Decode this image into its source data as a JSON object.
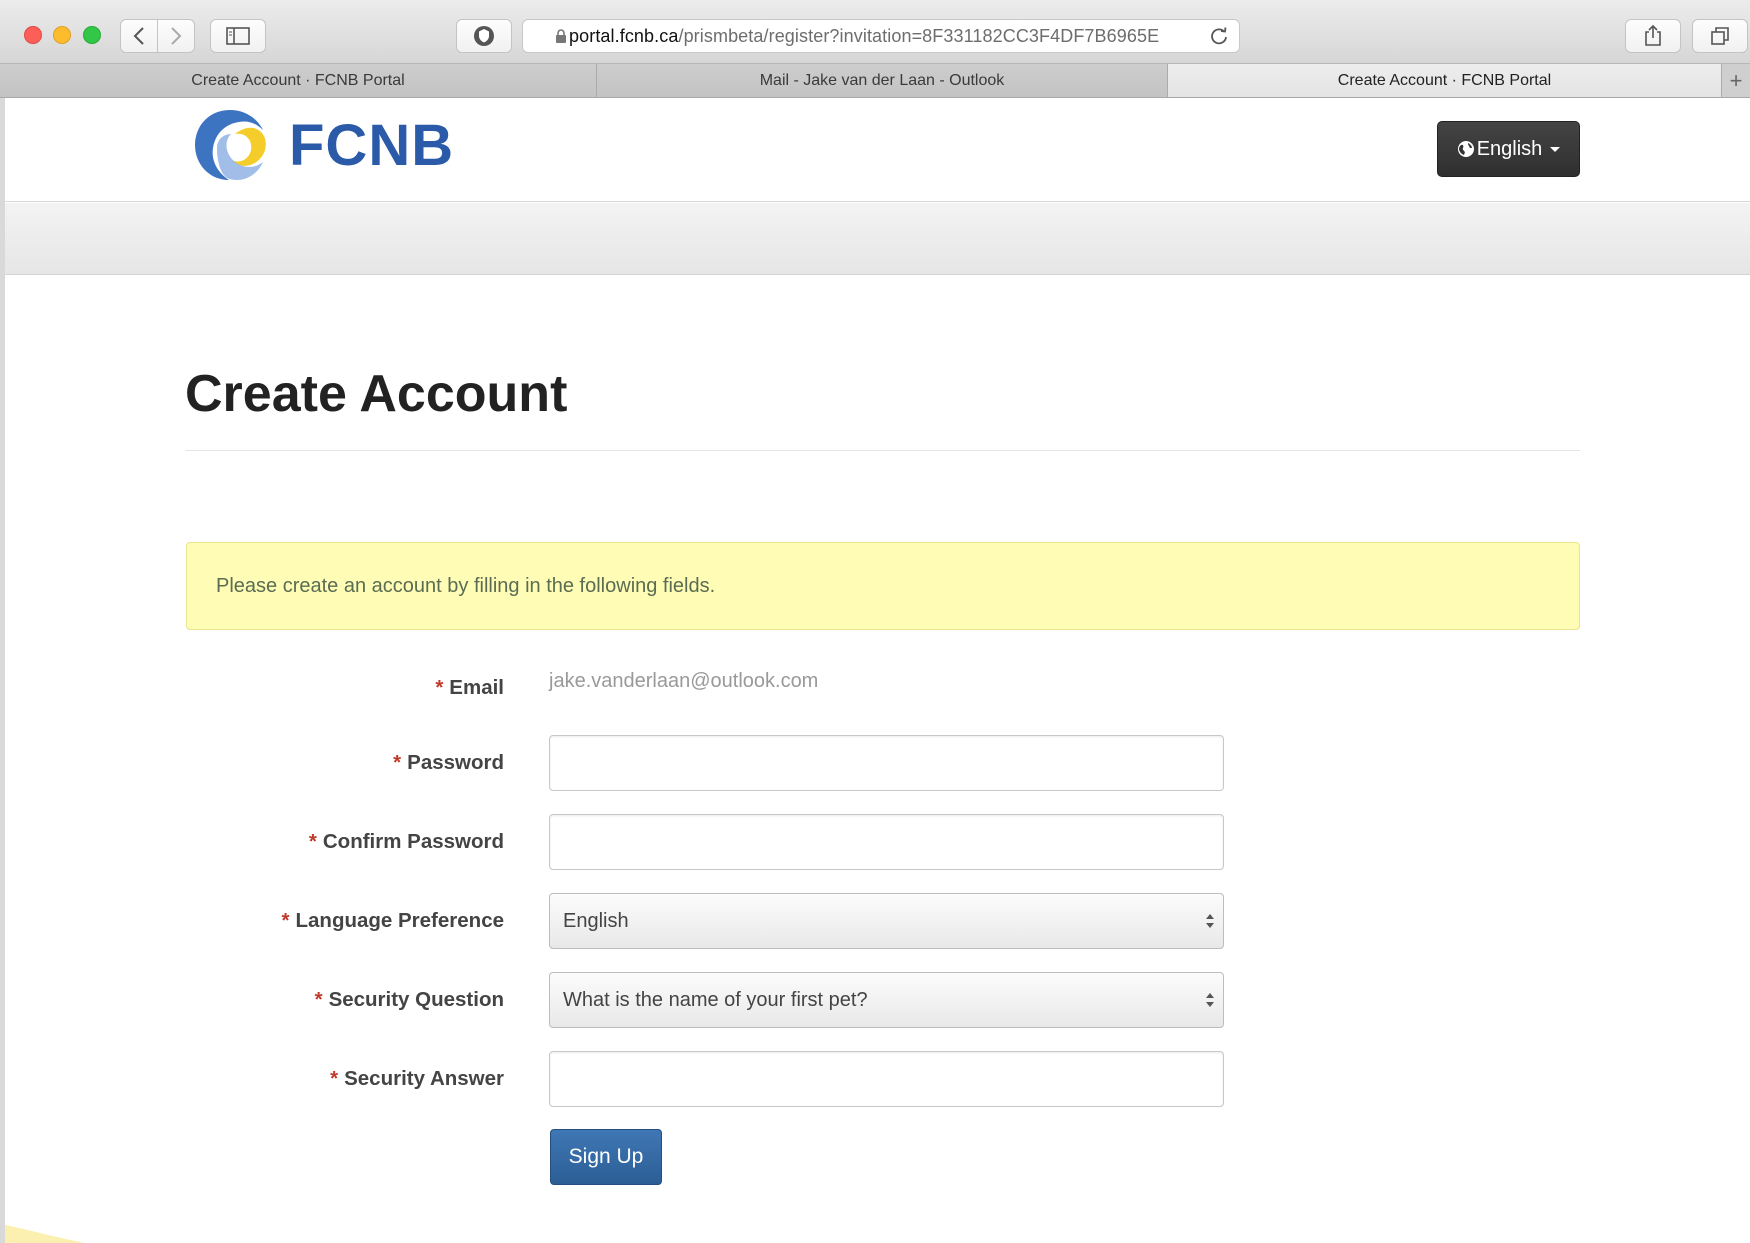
{
  "browser": {
    "url_host": "portal.fcnb.ca",
    "url_path": "/prismbeta/register?invitation=8F331182CC3F4DF7B6965E",
    "tabs": [
      {
        "label": "Create Account  · FCNB Portal",
        "active": false
      },
      {
        "label": "Mail - Jake van der Laan - Outlook",
        "active": false
      },
      {
        "label": "Create Account  · FCNB Portal",
        "active": true
      }
    ]
  },
  "header": {
    "logo_text": "FCNB",
    "language_button": "English"
  },
  "page": {
    "title": "Create Account",
    "alert": "Please create an account by filling in the following fields."
  },
  "form": {
    "email": {
      "label": "Email",
      "value": "jake.vanderlaan@outlook.com"
    },
    "password": {
      "label": "Password",
      "value": ""
    },
    "confirm_password": {
      "label": "Confirm Password",
      "value": ""
    },
    "language_preference": {
      "label": "Language Preference",
      "value": "English"
    },
    "security_question": {
      "label": "Security Question",
      "value": "What is the name of your first pet?"
    },
    "security_answer": {
      "label": "Security Answer",
      "value": ""
    },
    "required_marker": "*",
    "submit_label": "Sign Up"
  },
  "colors": {
    "brand_blue": "#2b5ba8",
    "alert_bg": "#fefcb5",
    "primary_button": "#3a6ea8",
    "required": "#c0392b"
  }
}
